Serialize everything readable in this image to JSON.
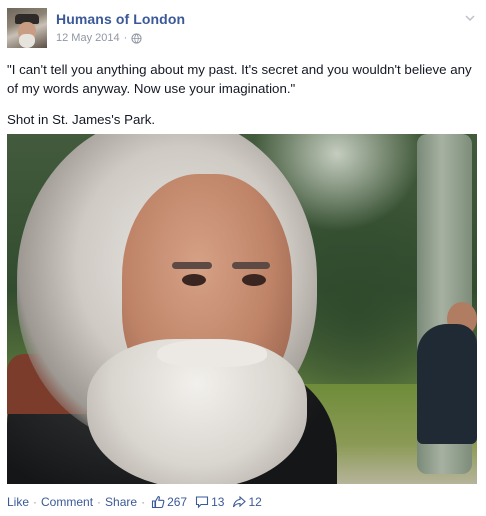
{
  "post": {
    "page_name": "Humans of London",
    "date": "12 May 2014",
    "dot": "·",
    "paragraphs": [
      "\"I can't tell you anything about my past. It's secret and you wouldn't believe any of my words anyway. Now use your imagination.\"",
      "Shot in St. James's Park."
    ],
    "icons": {
      "privacy": "globe-icon",
      "options": "chevron-down-icon",
      "likes": "thumbs-up-icon",
      "comments": "comment-bubble-icon",
      "shares": "share-arrow-icon"
    },
    "colors": {
      "link": "#3b5998",
      "meta": "#9197a3",
      "text": "#141823"
    }
  },
  "actions": {
    "like_label": "Like",
    "comment_label": "Comment",
    "share_label": "Share",
    "separator": "·",
    "likes_count": "267",
    "comments_count": "13",
    "shares_count": "12"
  }
}
